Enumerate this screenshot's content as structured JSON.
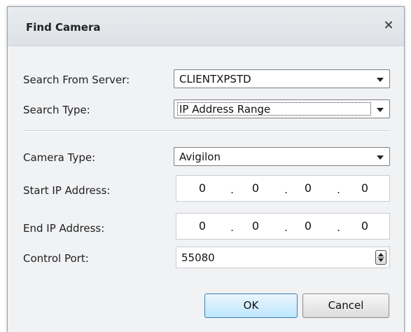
{
  "dialog": {
    "title": "Find Camera",
    "close_symbol": "×"
  },
  "form": {
    "search_from_server": {
      "label": "Search From Server:",
      "value": "CLIENTXPSTD"
    },
    "search_type": {
      "label": "Search Type:",
      "value": "IP Address Range"
    },
    "camera_type": {
      "label": "Camera Type:",
      "value": "Avigilon"
    },
    "start_ip": {
      "label": "Start IP Address:",
      "octets": [
        "0",
        "0",
        "0",
        "0"
      ]
    },
    "end_ip": {
      "label": "End IP Address:",
      "octets": [
        "0",
        "0",
        "0",
        "0"
      ]
    },
    "control_port": {
      "label": "Control Port:",
      "value": "55080"
    },
    "ip_separator": "."
  },
  "buttons": {
    "ok": "OK",
    "cancel": "Cancel"
  },
  "icons": {
    "close": "close-icon",
    "dropdown": "chevron-down-icon",
    "spinner": "spinner-icon"
  }
}
